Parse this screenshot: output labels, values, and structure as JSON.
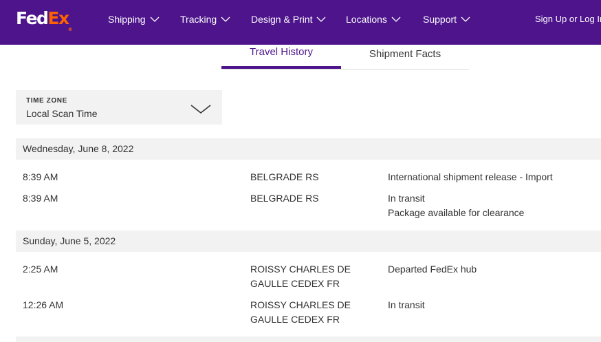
{
  "brand": {
    "fed": "FedEx",
    "purple": "#4d148c",
    "orange": "#ff6200"
  },
  "nav": {
    "items": [
      {
        "label": "Shipping"
      },
      {
        "label": "Tracking"
      },
      {
        "label": "Design & Print"
      },
      {
        "label": "Locations"
      },
      {
        "label": "Support"
      }
    ],
    "signin": "Sign Up or Log In"
  },
  "tabs": {
    "active": "Travel History",
    "inactive": "Shipment Facts"
  },
  "timezone": {
    "label": "TIME ZONE",
    "value": "Local Scan Time"
  },
  "history": {
    "days": [
      {
        "date": "Wednesday, June 8, 2022",
        "events": [
          {
            "time": "8:39 AM",
            "location": "BELGRADE RS",
            "status": "International shipment release - Import",
            "detail": ""
          },
          {
            "time": "8:39 AM",
            "location": "BELGRADE RS",
            "status": "In transit",
            "detail": "Package available for clearance"
          }
        ]
      },
      {
        "date": "Sunday, June 5, 2022",
        "events": [
          {
            "time": "2:25 AM",
            "location": "ROISSY CHARLES DE GAULLE CEDEX FR",
            "status": "Departed FedEx hub",
            "detail": ""
          },
          {
            "time": "12:26 AM",
            "location": "ROISSY CHARLES DE GAULLE CEDEX FR",
            "status": "In transit",
            "detail": ""
          }
        ]
      }
    ]
  }
}
